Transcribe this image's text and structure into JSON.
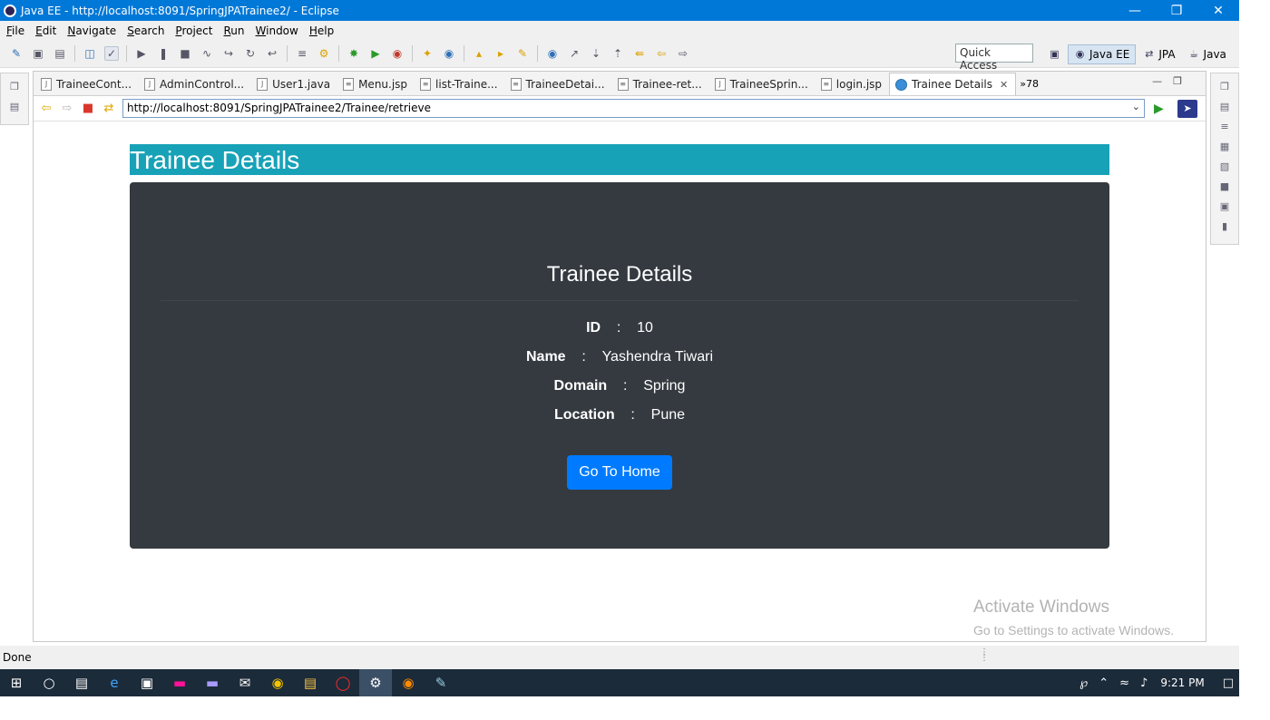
{
  "window": {
    "title": "Java EE - http://localhost:8091/SpringJPATrainee2/ - Eclipse"
  },
  "menu": [
    "File",
    "Edit",
    "Navigate",
    "Search",
    "Project",
    "Run",
    "Window",
    "Help"
  ],
  "toolbar": {
    "quick_access": "Quick Access",
    "perspectives": [
      {
        "label": "Java EE",
        "active": true
      },
      {
        "label": "JPA",
        "active": false
      },
      {
        "label": "Java",
        "active": false
      }
    ]
  },
  "editor_tabs": [
    {
      "label": "TraineeCont...",
      "icon": "java-file-icon"
    },
    {
      "label": "AdminControl...",
      "icon": "java-file-icon"
    },
    {
      "label": "User1.java",
      "icon": "java-file-icon"
    },
    {
      "label": "Menu.jsp",
      "icon": "jsp-file-icon"
    },
    {
      "label": "list-Traine...",
      "icon": "jsp-file-icon"
    },
    {
      "label": "TraineeDetai...",
      "icon": "jsp-file-icon"
    },
    {
      "label": "Trainee-ret...",
      "icon": "jsp-file-icon"
    },
    {
      "label": "TraineeSprin...",
      "icon": "java-file-icon"
    },
    {
      "label": "login.jsp",
      "icon": "jsp-file-icon"
    }
  ],
  "active_tab": {
    "label": "Trainee Details",
    "close": "✕"
  },
  "tab_overflow": "»78",
  "browser": {
    "url": "http://localhost:8091/SpringJPATrainee2/Trainee/retrieve"
  },
  "page": {
    "header": "Trainee Details",
    "card_title": "Trainee Details",
    "fields": [
      {
        "label": "ID",
        "value": "10"
      },
      {
        "label": "Name",
        "value": "Yashendra Tiwari"
      },
      {
        "label": "Domain",
        "value": "Spring"
      },
      {
        "label": "Location",
        "value": "Pune"
      }
    ],
    "separator": ":",
    "home_button": "Go To Home",
    "header_color": "#17a2b8",
    "card_color": "#343a40",
    "button_color": "#007bff"
  },
  "watermark": {
    "line1": "Activate Windows",
    "line2": "Go to Settings to activate Windows."
  },
  "status": {
    "text": "Done"
  },
  "taskbar": {
    "time": "9:21 PM"
  }
}
